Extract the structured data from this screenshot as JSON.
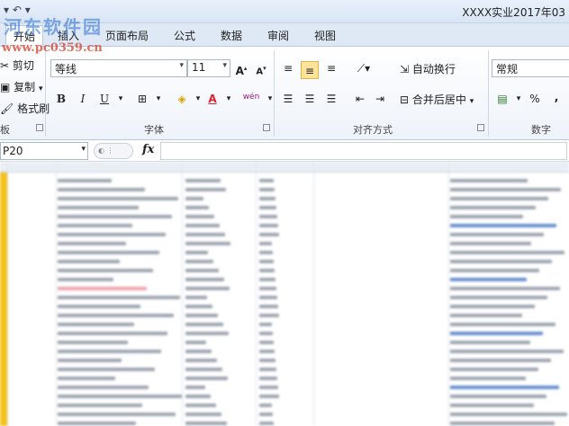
{
  "titlebar": {
    "qat": "▾ ↶ ▾",
    "title": "XXXX实业2017年03"
  },
  "watermark": {
    "cn": "河东软件园",
    "url": "www.pc0359.cn"
  },
  "tabs": {
    "home": "开始",
    "insert": "插入",
    "page_layout": "页面布局",
    "formulas": "公式",
    "data": "数据",
    "review": "审阅",
    "view": "视图"
  },
  "clipboard": {
    "cut": "剪切",
    "copy": "复制",
    "format_painter": "格式刷",
    "label": "板"
  },
  "font": {
    "name": "等线",
    "size": "11",
    "grow": "A",
    "shrink": "A",
    "bold": "B",
    "italic": "I",
    "underline": "U",
    "wen": "wén",
    "label": "字体"
  },
  "alignment": {
    "wrap_text": "自动换行",
    "merge_center": "合并后居中",
    "label": "对齐方式"
  },
  "number": {
    "format": "常规",
    "percent": "%",
    "comma": ",",
    "label": "数字"
  },
  "formula_bar": {
    "name_box": "P20",
    "fx": "fx"
  },
  "colors": {
    "ribbon_tab_bg": "#dfe9f5",
    "accent_yellow": "#f4c21a",
    "pressed": "#fde49a",
    "font_color": "#d9232d"
  }
}
